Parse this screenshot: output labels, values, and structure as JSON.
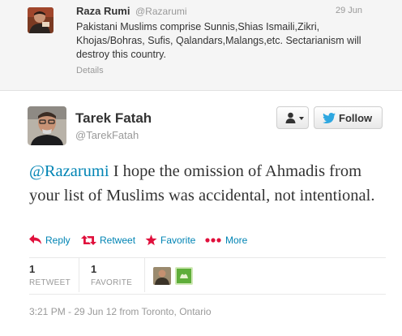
{
  "context_tweet": {
    "name": "Raza Rumi",
    "handle": "@Razarumi",
    "date": "29 Jun",
    "text": "Pakistani Muslims comprise Sunnis,Shias Ismaili,Zikri, Khojas/Bohras, Sufis, Qalandars,Malangs,etc. Sectarianism will destroy this country.",
    "details_label": "Details"
  },
  "main_tweet": {
    "name": "Tarek Fatah",
    "handle": "@TarekFatah",
    "follow_label": "Follow",
    "mention": "@Razarumi",
    "text": " I hope the omission of Ahmadis from your list of Muslims was accidental, not intentional.",
    "actions": {
      "reply": "Reply",
      "retweet": "Retweet",
      "favorite": "Favorite",
      "more": "More"
    },
    "stats": {
      "retweets": {
        "count": "1",
        "label": "RETWEET"
      },
      "favorites": {
        "count": "1",
        "label": "FAVORITE"
      }
    },
    "timestamp": "3:21 PM - 29 Jun 12 from Toronto, Ontario"
  },
  "colors": {
    "link": "#0084b4",
    "favorite": "#e0103c",
    "muted": "#999999",
    "text": "#333333"
  },
  "icons": [
    "person-icon",
    "caret-down-icon",
    "twitter-bird-icon",
    "reply-icon",
    "retweet-icon",
    "star-icon",
    "more-dots-icon"
  ]
}
